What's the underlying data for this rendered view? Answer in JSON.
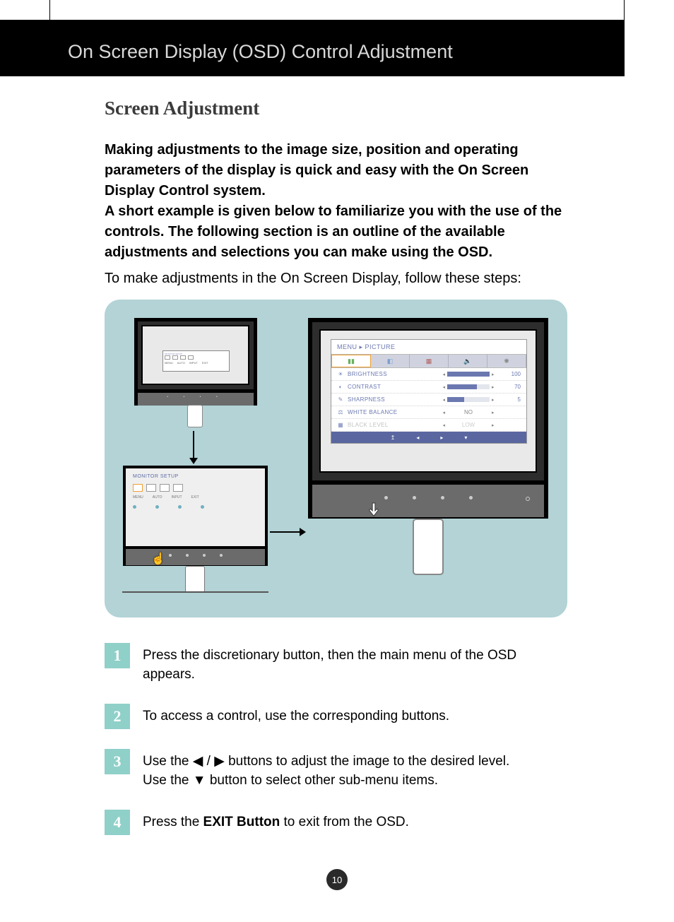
{
  "header": {
    "title": "On Screen Display (OSD) Control Adjustment"
  },
  "section": {
    "title": "Screen Adjustment",
    "intro": "Making adjustments to the image size, position and operating parameters of the display is quick and easy with the On Screen Display Control system.\nA short example is given below to familiarize you with the use of the controls. The following section is an outline of the available adjustments and selections you can make using the OSD.",
    "lead": "To make adjustments in the On Screen Display, follow these steps:"
  },
  "osd_setup": {
    "title": "MONITOR SETUP",
    "labels": [
      "MENU",
      "AUTO",
      "INPUT",
      "EXIT"
    ]
  },
  "osd_menu": {
    "breadcrumb": "MENU ▸ PICTURE",
    "rows": [
      {
        "icon": "☀",
        "label": "BRIGHTNESS",
        "fill": 100,
        "value": "100"
      },
      {
        "icon": "◐",
        "label": "CONTRAST",
        "fill": 70,
        "value": "70"
      },
      {
        "icon": "✎",
        "label": "SHARPNESS",
        "fill": 40,
        "value": "5"
      },
      {
        "icon": "⚖",
        "label": "WHITE BALANCE",
        "text": "NO"
      },
      {
        "icon": "▦",
        "label": "BLACK LEVEL",
        "text": "LOW",
        "disabled": true
      }
    ],
    "footer": [
      "↥",
      "◂",
      "▸",
      "▾"
    ]
  },
  "steps": [
    {
      "n": "1",
      "text": "Press the discretionary button, then the main menu of the OSD appears."
    },
    {
      "n": "2",
      "text": "To access a control, use the corresponding buttons."
    },
    {
      "n": "3",
      "line1_pre": "Use the  ",
      "line1_glyph": "◀ / ▶",
      "line1_post": "  buttons to adjust the image to the desired level.",
      "line2_pre": "Use the ",
      "line2_glyph": "▼",
      "line2_post": "  button to select other sub-menu items."
    },
    {
      "n": "4",
      "pre": "Press the ",
      "bold": "EXIT Button",
      "post": " to exit from the OSD."
    }
  ],
  "page_number": "10"
}
